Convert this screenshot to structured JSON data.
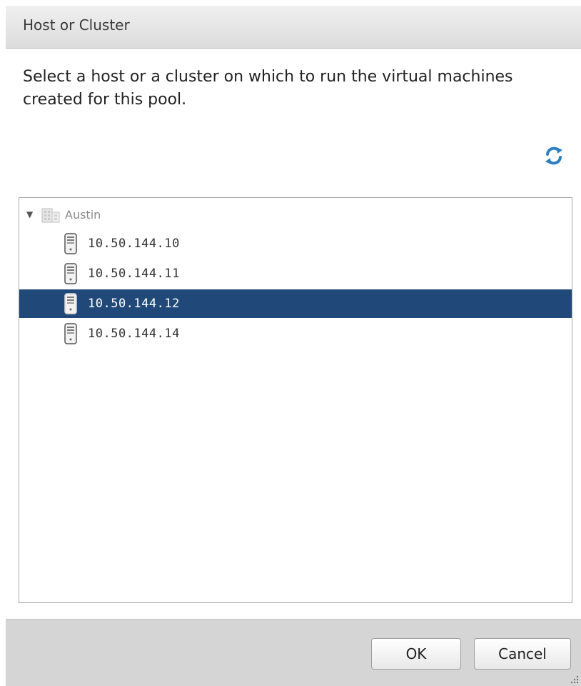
{
  "dialog": {
    "title": "Host or Cluster",
    "description": "Select a host or a cluster on which to run the virtual machines created for this pool.",
    "refresh_icon": "refresh-icon"
  },
  "tree": {
    "root": {
      "label": "Austin",
      "icon": "datacenter-icon",
      "expanded": true
    },
    "hosts": [
      {
        "label": "10.50.144.10",
        "icon": "server-icon",
        "selected": false
      },
      {
        "label": "10.50.144.11",
        "icon": "server-icon",
        "selected": false
      },
      {
        "label": "10.50.144.12",
        "icon": "server-icon",
        "selected": true
      },
      {
        "label": "10.50.144.14",
        "icon": "server-icon",
        "selected": false
      }
    ],
    "selection_color": "#20497a"
  },
  "buttons": {
    "ok_label": "OK",
    "cancel_label": "Cancel"
  }
}
